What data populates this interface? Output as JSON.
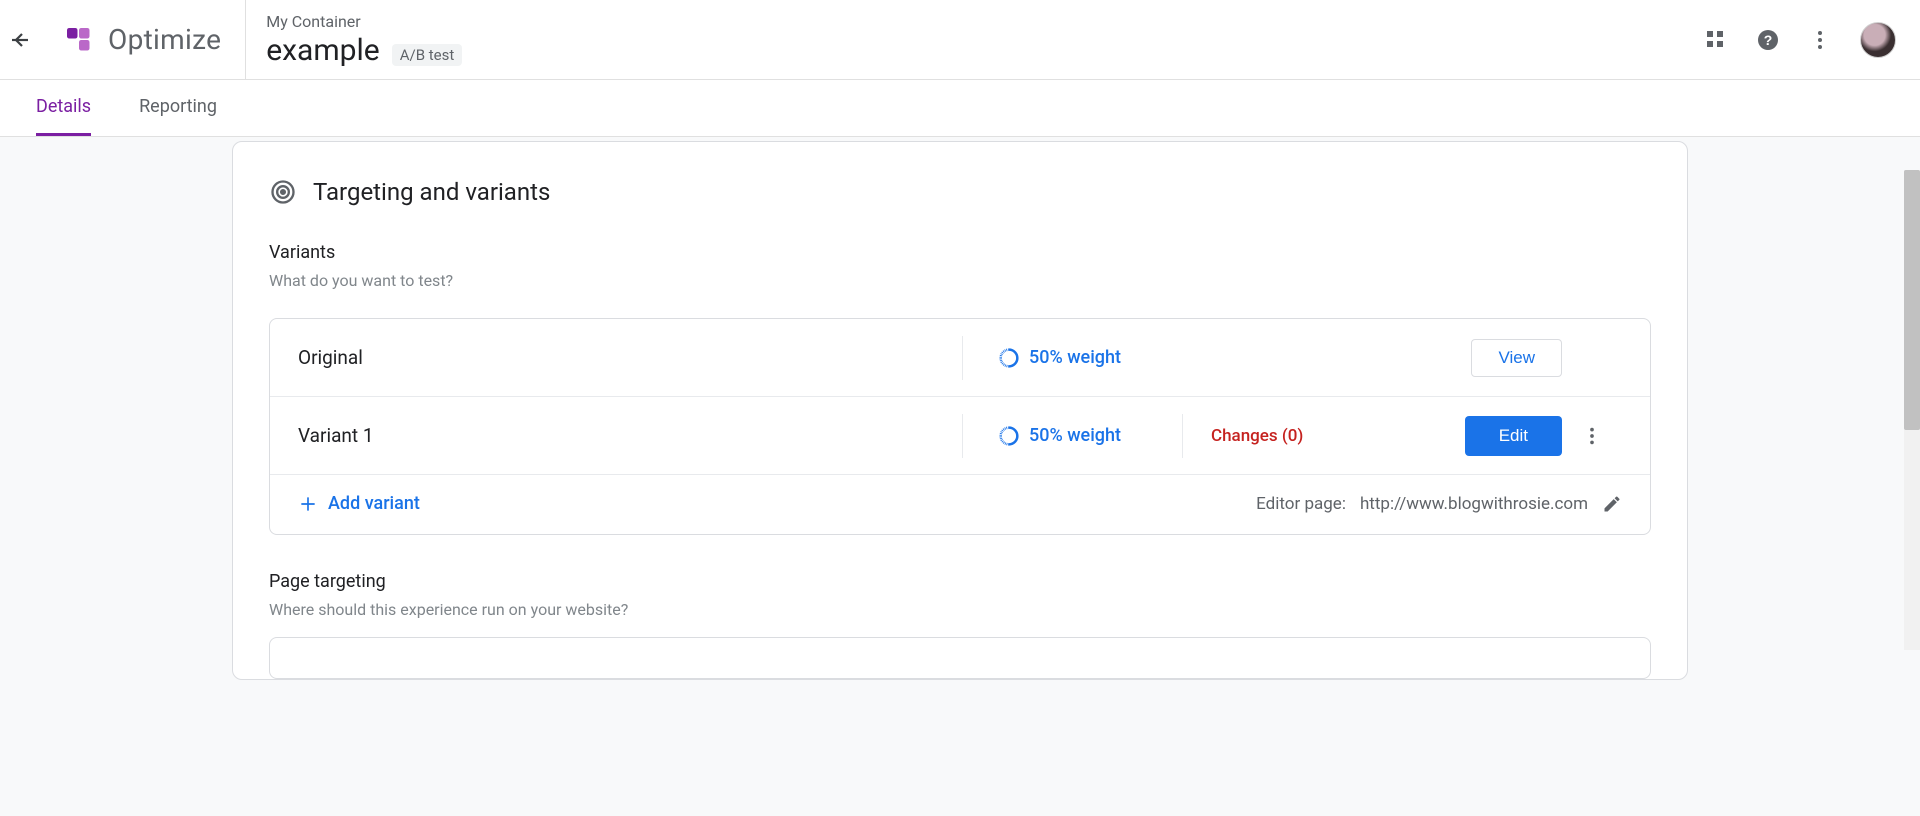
{
  "header": {
    "product_name": "Optimize",
    "container_name": "My Container",
    "experiment_name": "example",
    "experiment_type": "A/B test"
  },
  "tabs": {
    "details": "Details",
    "reporting": "Reporting"
  },
  "section": {
    "targeting_variants_title": "Targeting and variants"
  },
  "variants_section": {
    "title": "Variants",
    "description": "What do you want to test?"
  },
  "variants": {
    "original": {
      "name": "Original",
      "weight": "50% weight",
      "view_label": "View"
    },
    "v1": {
      "name": "Variant 1",
      "weight": "50% weight",
      "changes": "Changes (0)",
      "edit_label": "Edit"
    }
  },
  "add_variant_label": "Add variant",
  "editor_page": {
    "label": "Editor page:",
    "url": "http://www.blogwithrosie.com"
  },
  "page_targeting": {
    "title": "Page targeting",
    "description": "Where should this experience run on your website?"
  }
}
